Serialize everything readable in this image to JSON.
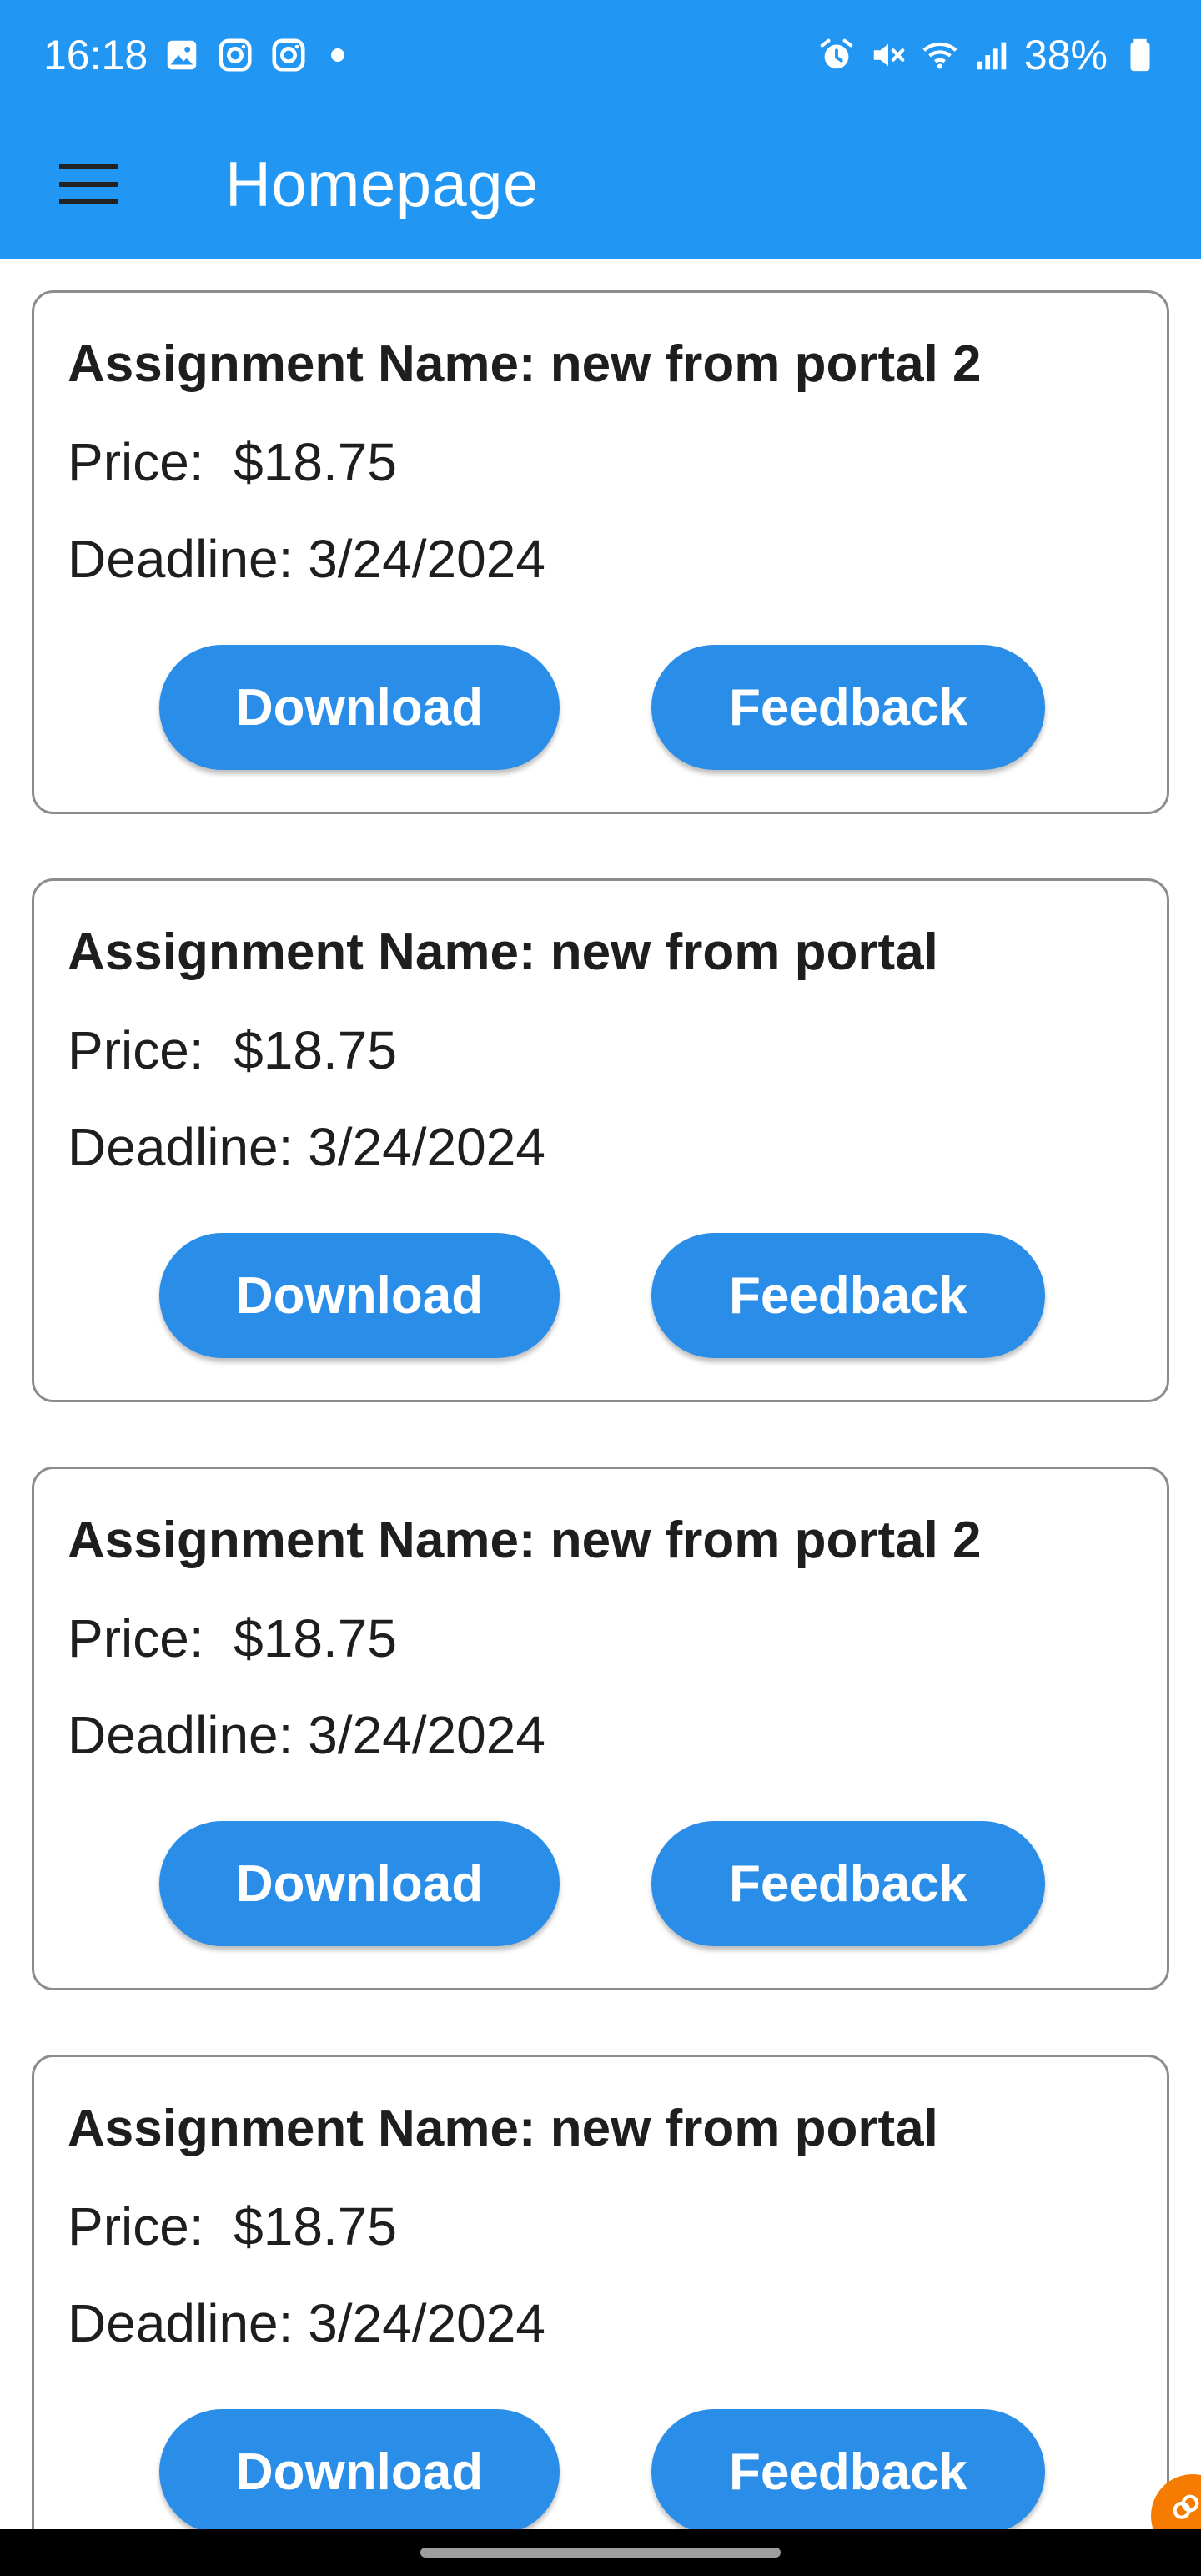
{
  "status_bar": {
    "time": "16:18",
    "battery": "38%",
    "icons_left": [
      "gallery-icon",
      "instagram-icon",
      "instagram-icon",
      "dot"
    ],
    "icons_right": [
      "alarm-icon",
      "mute-icon",
      "wifi-icon",
      "signal-icon",
      "battery-icon"
    ]
  },
  "app_bar": {
    "title": "Homepage",
    "menu_icon": "hamburger-menu-icon",
    "background": "#2196f3"
  },
  "assignments": [
    {
      "title": "Assignment Name: new from portal 2",
      "price": "Price:  $18.75",
      "deadline": "Deadline: 3/24/2024",
      "download_label": "Download",
      "feedback_label": "Feedback"
    },
    {
      "title": "Assignment Name: new from portal",
      "price": "Price:  $18.75",
      "deadline": "Deadline: 3/24/2024",
      "download_label": "Download",
      "feedback_label": "Feedback"
    },
    {
      "title": "Assignment Name: new from portal 2",
      "price": "Price:  $18.75",
      "deadline": "Deadline: 3/24/2024",
      "download_label": "Download",
      "feedback_label": "Feedback"
    },
    {
      "title": "Assignment Name: new from portal",
      "price": "Price:  $18.75",
      "deadline": "Deadline: 3/24/2024",
      "download_label": "Download",
      "feedback_label": "Feedback"
    }
  ],
  "colors": {
    "primary": "#2196f3",
    "button": "#2a8de8",
    "card_border": "#8c8c8c",
    "floating_bubble": "#f57c00"
  }
}
